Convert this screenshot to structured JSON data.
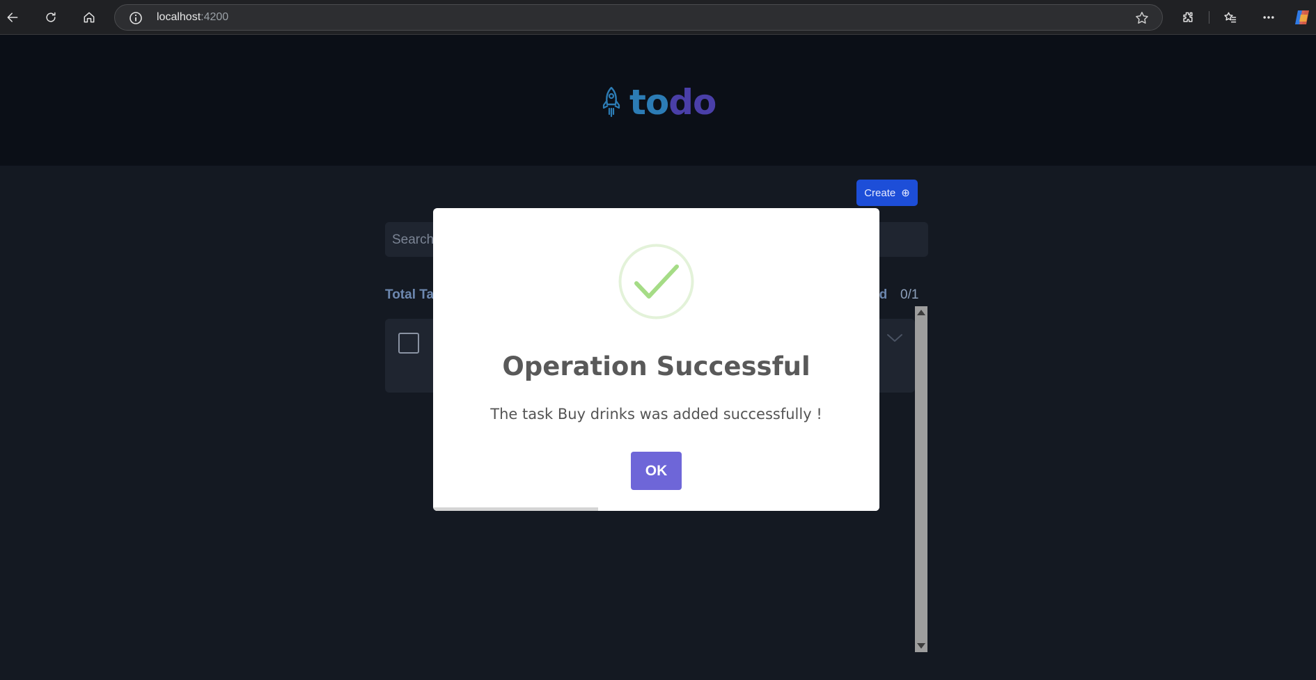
{
  "browser": {
    "url_host": "localhost",
    "url_port": ":4200"
  },
  "app": {
    "logo_part1": "to",
    "logo_part2": "do",
    "create_label": "Create",
    "create_icon": "⊕",
    "search_placeholder": "Search",
    "total_label": "Total Ta",
    "completed_label": "ed",
    "completed_count": "0/1"
  },
  "modal": {
    "title": "Operation Successful",
    "message": "The task Buy drinks was added successfully !",
    "ok_label": "OK",
    "timer_progress": 0.37
  },
  "colors": {
    "accent_create": "#1d4ed8",
    "ok_button": "#6e66d8",
    "success_green": "#a5dc86"
  }
}
